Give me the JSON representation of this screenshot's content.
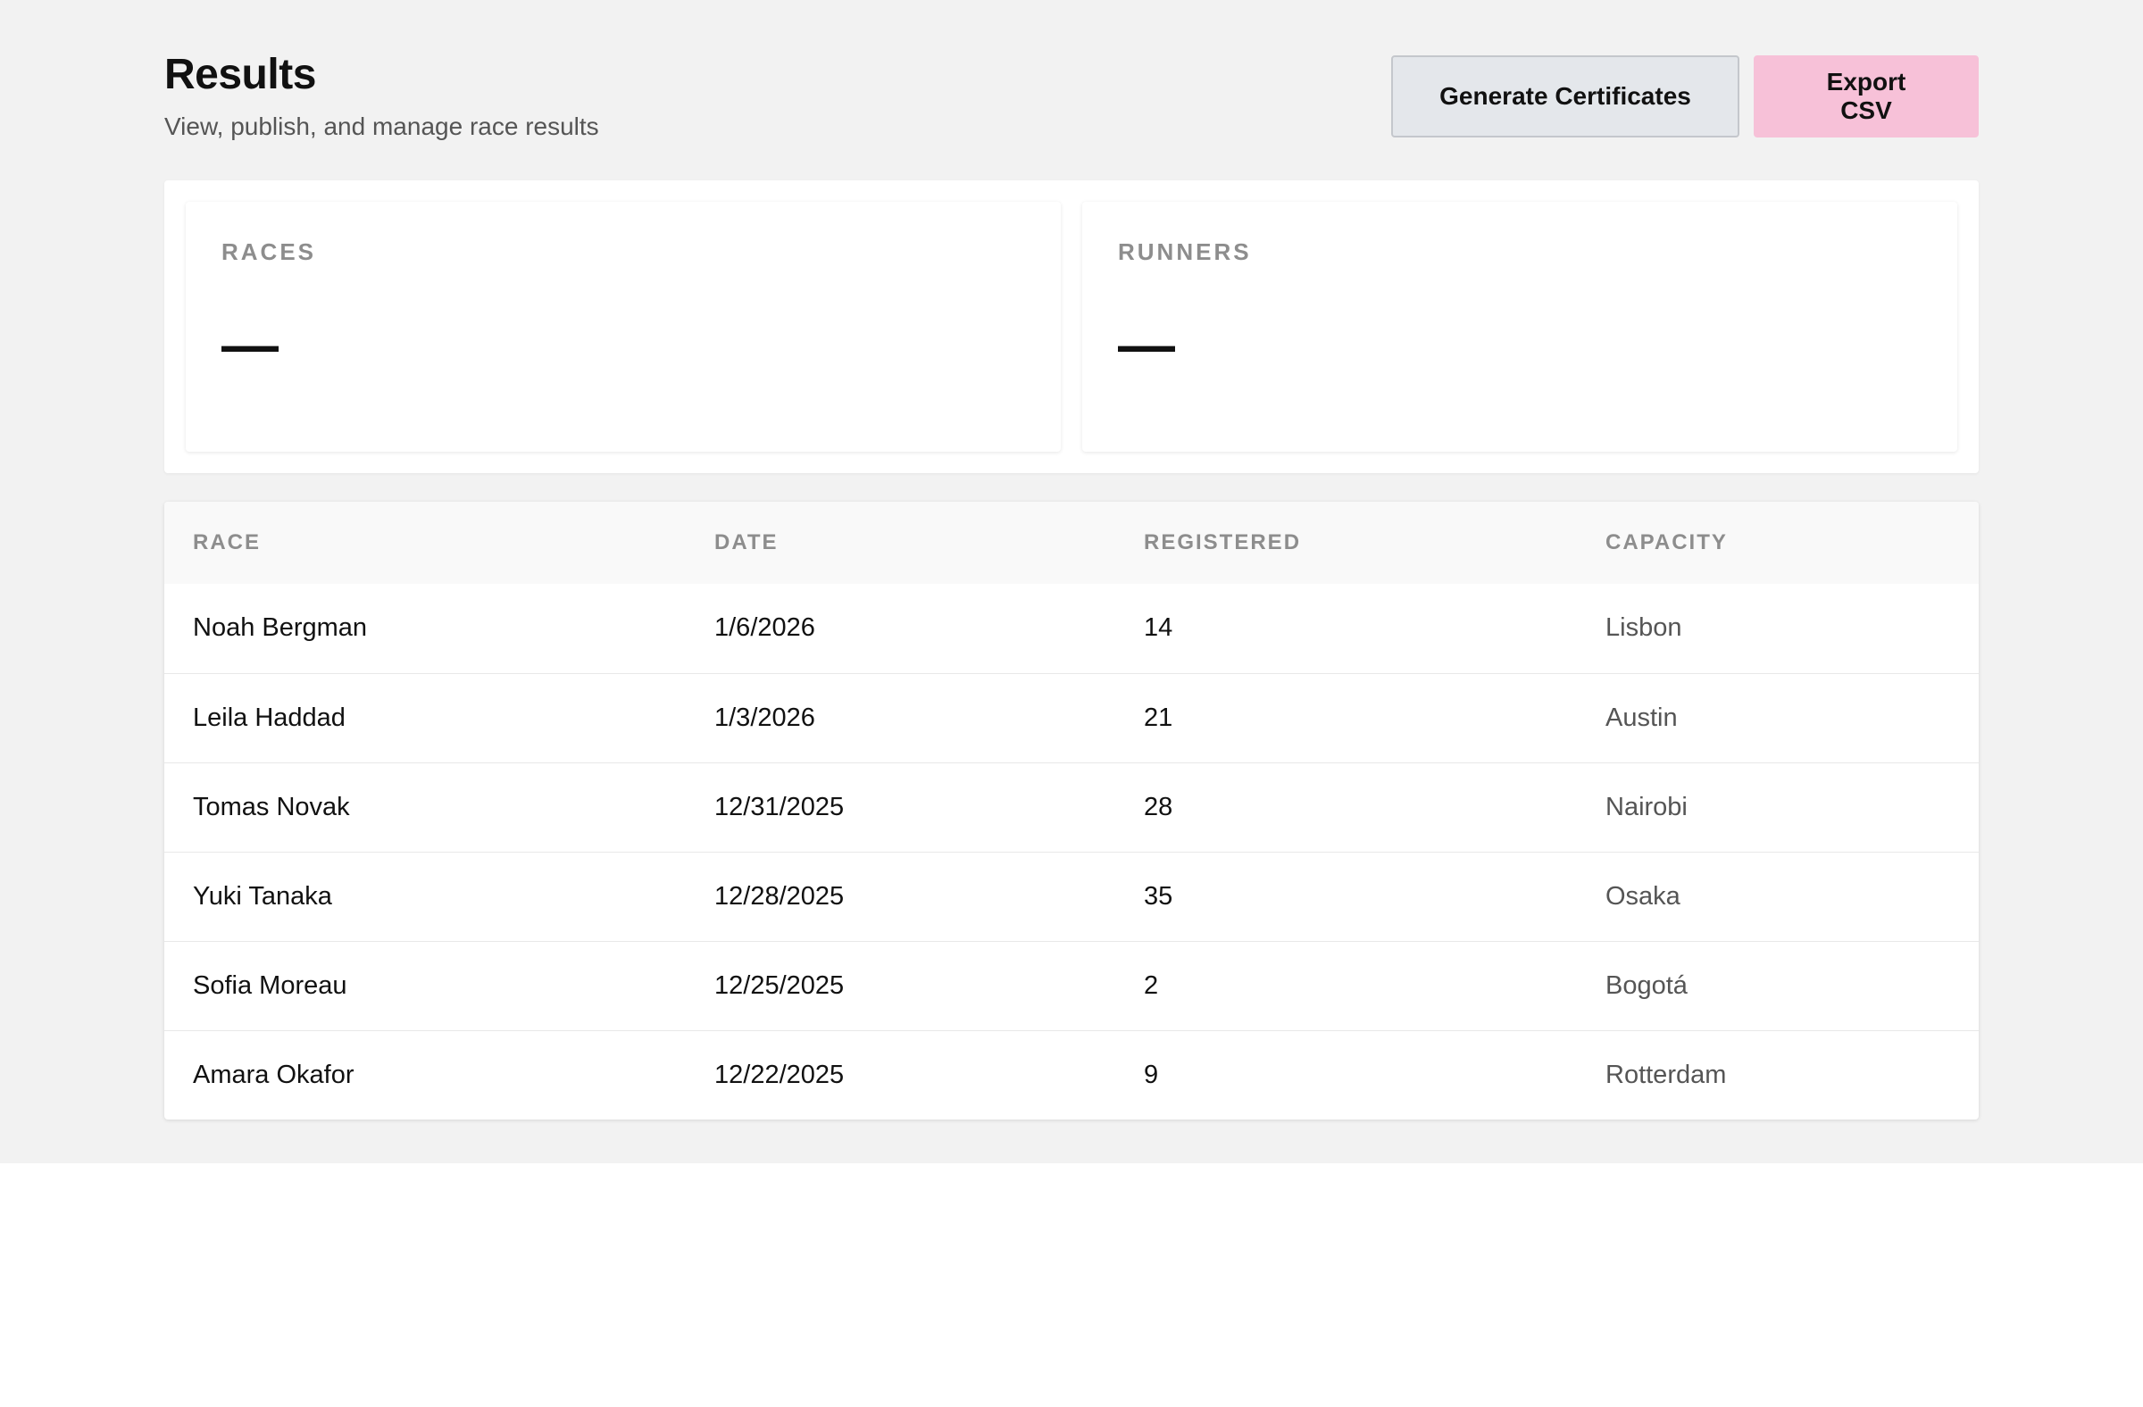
{
  "header": {
    "title": "Results",
    "subtitle": "View, publish, and manage race results",
    "generate_label": "Generate Certificates",
    "export_label": "Export CSV"
  },
  "stats": [
    {
      "label": "RACES",
      "value": "—"
    },
    {
      "label": "RUNNERS",
      "value": "—"
    }
  ],
  "table": {
    "columns": [
      "RACE",
      "DATE",
      "REGISTERED",
      "CAPACITY"
    ],
    "rows": [
      [
        "Noah Bergman",
        "1/6/2026",
        "14",
        "Lisbon"
      ],
      [
        "Leila Haddad",
        "1/3/2026",
        "21",
        "Austin"
      ],
      [
        "Tomas Novak",
        "12/31/2025",
        "28",
        "Nairobi"
      ],
      [
        "Yuki Tanaka",
        "12/28/2025",
        "35",
        "Osaka"
      ],
      [
        "Sofia Moreau",
        "12/25/2025",
        "2",
        "Bogotá"
      ],
      [
        "Amara Okafor",
        "12/22/2025",
        "9",
        "Rotterdam"
      ]
    ]
  },
  "colors": {
    "background": "#f2f2f2",
    "primary_button": "#f7c1d8",
    "secondary_button": "#e4e7eb"
  }
}
